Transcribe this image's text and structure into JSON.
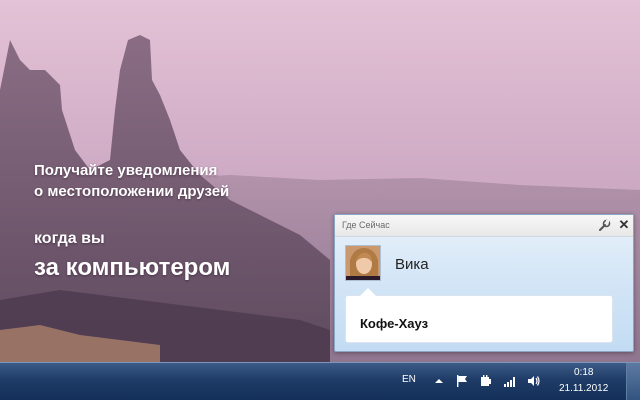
{
  "promo": {
    "line1": "Получайте уведомления",
    "line2": "о местоположении друзей",
    "line3": "когда вы",
    "line4": "за компьютером"
  },
  "gadget": {
    "title": "Где Сейчас",
    "friend_name": "Вика",
    "place": "Кофе-Хауз",
    "close_glyph": "✕"
  },
  "taskbar": {
    "language": "EN",
    "time": "0:18",
    "date": "21.11.2012",
    "tray_icons": [
      "chevron-up-icon",
      "flag-icon",
      "power-icon",
      "signal-icon",
      "speaker-icon"
    ]
  },
  "colors": {
    "taskbar": "#1e3c67",
    "gadget_bg": "#d6e7f7"
  }
}
